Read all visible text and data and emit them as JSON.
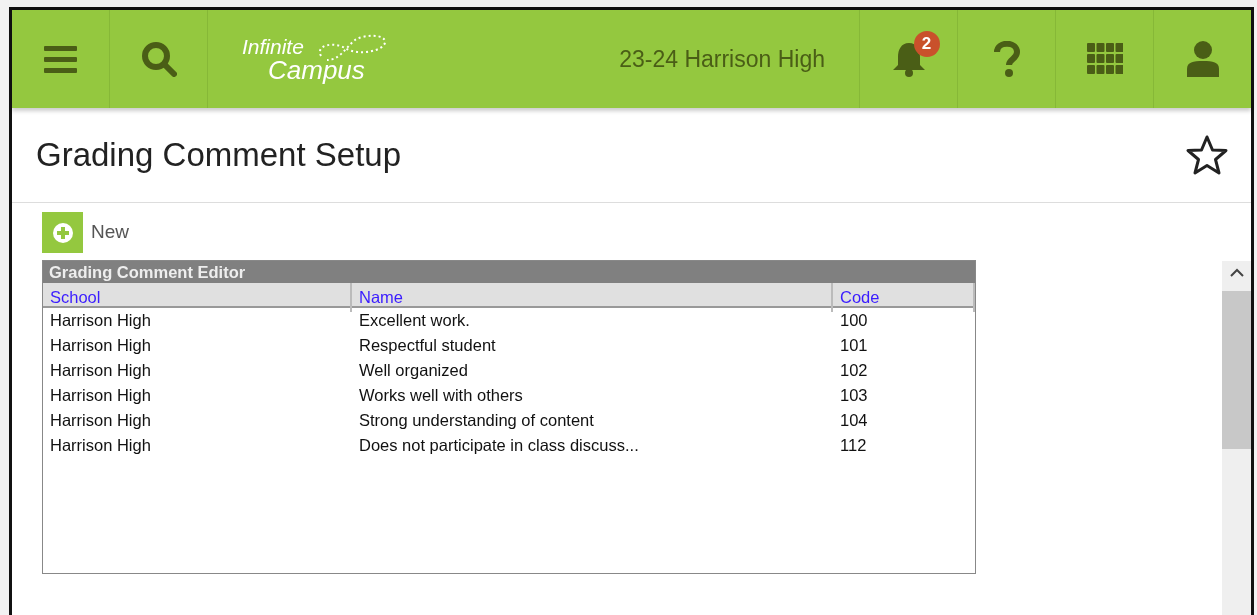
{
  "header": {
    "logo": {
      "line_1": "Infinite",
      "line_2": "Campus"
    },
    "context": "23-24 Harrison High",
    "notification_count": "2"
  },
  "page_title": "Grading Comment Setup",
  "favorite": {
    "selected": false
  },
  "new_button": {
    "label": "New"
  },
  "editor": {
    "title": "Grading Comment Editor",
    "columns": [
      "School",
      "Name",
      "Code"
    ],
    "rows": [
      [
        "Harrison High",
        "Excellent work.",
        "100"
      ],
      [
        "Harrison High",
        "Respectful student",
        "101"
      ],
      [
        "Harrison High",
        "Well organized",
        "102"
      ],
      [
        "Harrison High",
        "Works well with others",
        "103"
      ],
      [
        "Harrison High",
        "Strong understanding of content",
        "104"
      ],
      [
        "Harrison High",
        "Does not participate in class discuss...",
        "112"
      ]
    ]
  }
}
